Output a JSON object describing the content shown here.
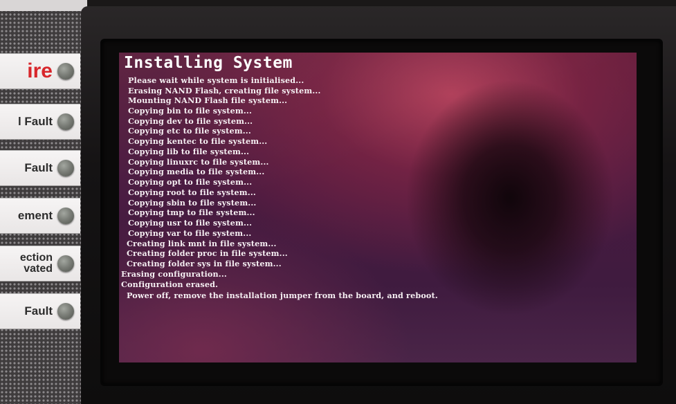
{
  "panel": {
    "indicators": [
      {
        "label": "ire",
        "style": "red"
      },
      {
        "label": "l Fault",
        "style": "normal"
      },
      {
        "label": "Fault",
        "style": "normal"
      },
      {
        "label": "ement",
        "style": "normal"
      },
      {
        "label": "ection\nvated",
        "style": "two-line"
      },
      {
        "label": "Fault",
        "style": "normal"
      }
    ],
    "label_red_color": "#d8262b",
    "led_color": "#7a7d77"
  },
  "screen": {
    "title": "Installing System",
    "lines": [
      "Please wait while system is initialised...",
      "Erasing NAND Flash, creating file system...",
      "Mounting NAND Flash file system...",
      "Copying bin to file system...",
      "Copying dev to file system...",
      "Copying etc to file system...",
      "Copying kentec to file system...",
      "Copying lib to file system...",
      "Copying linuxrc to file system...",
      "Copying media to file system...",
      "Copying opt to file system...",
      "Copying root to file system...",
      "Copying sbin to file system...",
      "Copying tmp to file system...",
      "Copying usr to file system...",
      "Copying var to file system...",
      "Creating link mnt in file system...",
      "Creating folder proc in file system...",
      "Creating folder sys in file system...",
      "Erasing configuration...",
      "Configuration erased.",
      "Power off, remove the installation jumper from the board, and reboot."
    ],
    "text_color": "#f6f0f3",
    "background_color": "#4a1a40"
  }
}
